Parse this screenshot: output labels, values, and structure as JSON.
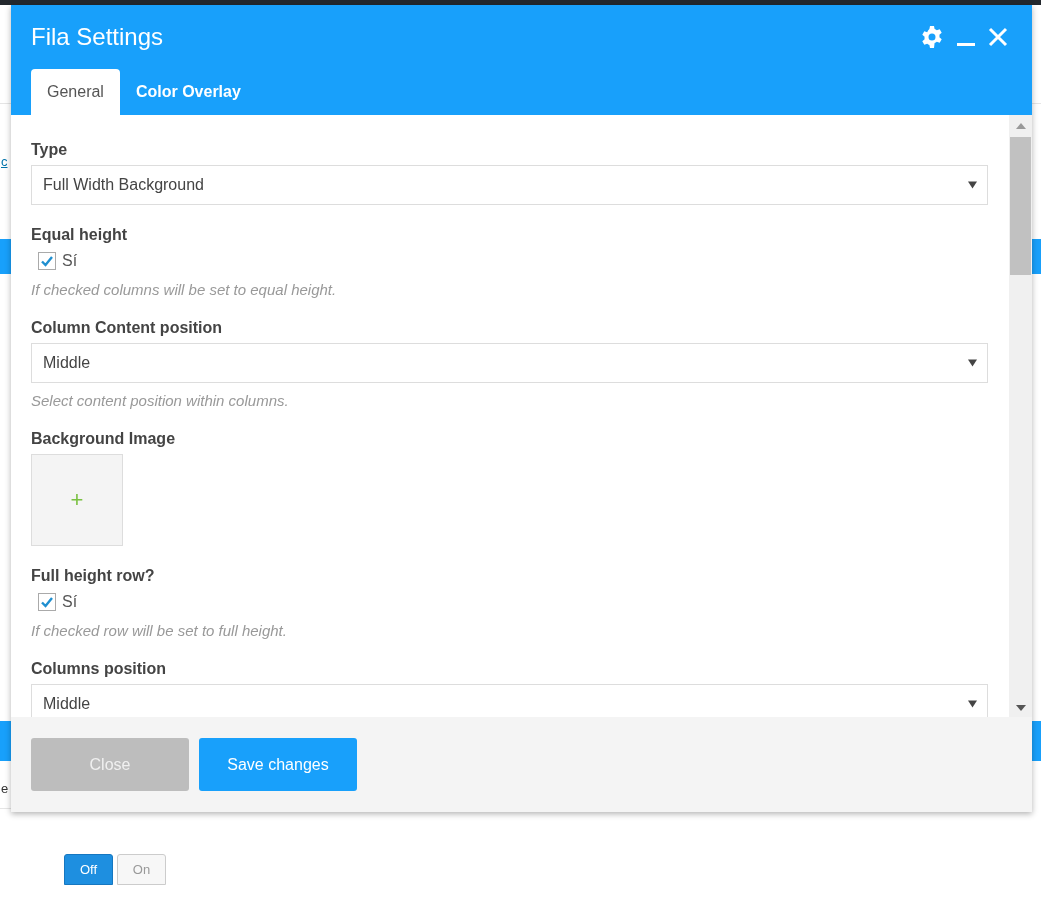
{
  "background": {
    "link_fragment": "c",
    "text_fragment": "e",
    "toggle": [
      {
        "label": "Off",
        "selected": true
      },
      {
        "label": "On",
        "selected": false
      }
    ]
  },
  "window": {
    "title": "Fila Settings"
  },
  "tabs": [
    {
      "label": "General",
      "selected": true
    },
    {
      "label": "Color Overlay",
      "selected": false
    }
  ],
  "fields": [
    {
      "kind": "select",
      "label": "Type",
      "value": "Full Width Background"
    },
    {
      "kind": "checkbox",
      "label": "Equal height",
      "option": "Sí",
      "checked": true,
      "help": "If checked columns will be set to equal height."
    },
    {
      "kind": "select",
      "label": "Column Content position",
      "value": "Middle",
      "help": "Select content position within columns."
    },
    {
      "kind": "image",
      "label": "Background Image",
      "add": "+"
    },
    {
      "kind": "checkbox",
      "label": "Full height row?",
      "option": "Sí",
      "checked": true,
      "help": "If checked row will be set to full height."
    },
    {
      "kind": "select",
      "label": "Columns position",
      "value": "Middle"
    }
  ],
  "buttons": [
    {
      "label": "Close",
      "kind": "secondary"
    },
    {
      "label": "Save changes",
      "kind": "primary"
    }
  ]
}
